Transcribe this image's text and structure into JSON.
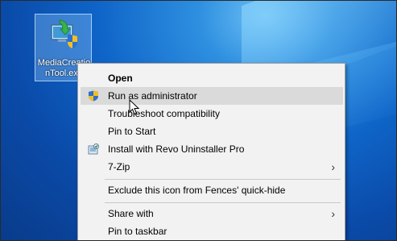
{
  "desktop_icon": {
    "label_line1": "MediaCreatio",
    "label_line2": "nTool.exe",
    "icon": "media-creation-tool-icon"
  },
  "context_menu": {
    "items": [
      {
        "label": "Open",
        "bold": true
      },
      {
        "label": "Run as administrator",
        "icon": "uac-shield-icon",
        "highlighted": true
      },
      {
        "label": "Troubleshoot compatibility"
      },
      {
        "label": "Pin to Start"
      },
      {
        "label": "Install with Revo Uninstaller Pro",
        "icon": "revo-uninstaller-icon"
      },
      {
        "label": "7-Zip",
        "submenu": true
      },
      {
        "label": "Exclude this icon from Fences' quick-hide"
      },
      {
        "label": "Share with",
        "submenu": true
      },
      {
        "label": "Pin to taskbar"
      }
    ]
  },
  "colors": {
    "menu_background": "#f2f2f2",
    "menu_highlight": "#dadada",
    "desktop_blue": "#0f64c7"
  }
}
